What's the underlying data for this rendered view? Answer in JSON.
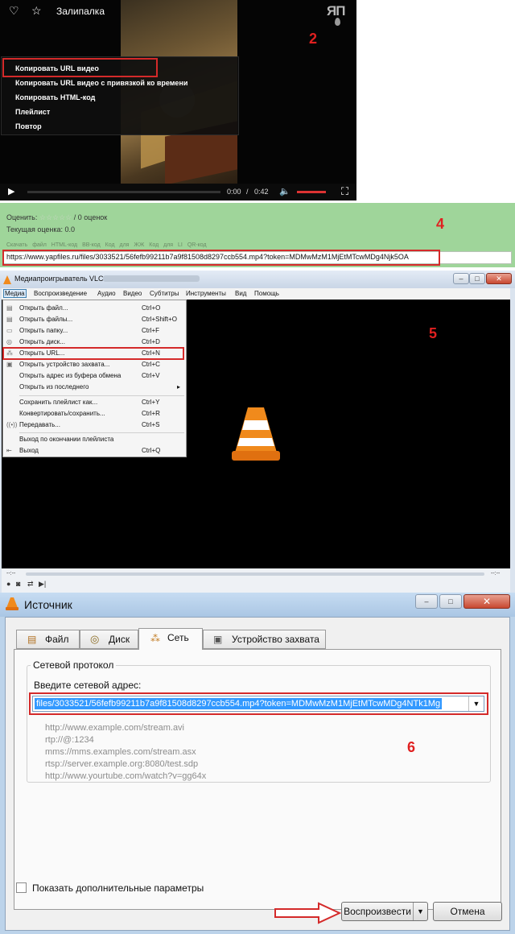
{
  "step_numbers": {
    "s2": "2",
    "s4": "4",
    "s5": "5",
    "s6": "6"
  },
  "player": {
    "title": "Залипалка",
    "logo": "ЯП",
    "context_menu": [
      "Копировать URL видео",
      "Копировать URL видео с привязкой ко времени",
      "Копировать HTML-код",
      "Плейлист",
      "Повтор"
    ],
    "time_current": "0:00",
    "time_separator": "/",
    "time_total": "0:42",
    "volume_fraction": 1.0
  },
  "rating": {
    "rate_label": "Оценить:",
    "stars": "☆☆☆☆☆",
    "rate_count": "/ 0 оценок",
    "current_rating": "Текущая оценка: 0.0",
    "links": "Скачать файл  HTML-код  BB-код  Код для ЖЖ  Код для LI  QR-код",
    "url": "https://www.yapfiles.ru/files/3033521/56fefb99211b7a9f81508d8297ccb554.mp4?token=MDMwMzM1MjEtMTcwMDg4Njk5OA"
  },
  "vlc": {
    "window_title": "Медиапроигрыватель VLC",
    "menubar": [
      "Медиа",
      "Воспроизведение",
      "Аудио",
      "Видео",
      "Субтитры",
      "Инструменты",
      "Вид",
      "Помощь"
    ],
    "media_menu": [
      {
        "label": "Открыть файл...",
        "shortcut": "Ctrl+O"
      },
      {
        "label": "Открыть файлы...",
        "shortcut": "Ctrl+Shift+O"
      },
      {
        "label": "Открыть папку...",
        "shortcut": "Ctrl+F"
      },
      {
        "label": "Открыть диск...",
        "shortcut": "Ctrl+D"
      },
      {
        "label": "Открыть URL...",
        "shortcut": "Ctrl+N"
      },
      {
        "label": "Открыть устройство захвата...",
        "shortcut": "Ctrl+C"
      },
      {
        "label": "Открыть адрес из буфера обмена",
        "shortcut": "Ctrl+V"
      },
      {
        "label": "Открыть из последнего",
        "shortcut": ""
      },
      {
        "label": "Сохранить плейлист как...",
        "shortcut": "Ctrl+Y"
      },
      {
        "label": "Конвертировать/сохранить...",
        "shortcut": "Ctrl+R"
      },
      {
        "label": "Передавать...",
        "shortcut": "Ctrl+S"
      },
      {
        "label": "Выход по окончании плейлиста",
        "shortcut": ""
      },
      {
        "label": "Выход",
        "shortcut": "Ctrl+Q"
      }
    ],
    "time_left": "--:--",
    "time_right": "--:--"
  },
  "source_dialog": {
    "title": "Источник",
    "tabs": [
      "Файл",
      "Диск",
      "Сеть",
      "Устройство захвата"
    ],
    "active_tab": "Сеть",
    "group_label": "Сетевой протокол",
    "address_label": "Введите сетевой адрес:",
    "address_value": "files/3033521/56fefb99211b7a9f81508d8297ccb554.mp4?token=MDMwMzM1MjEtMTcwMDg4NTk1Mg",
    "examples": [
      "http://www.example.com/stream.avi",
      "rtp://@:1234",
      "mms://mms.examples.com/stream.asx",
      "rtsp://server.example.org:8080/test.sdp",
      "http://www.yourtube.com/watch?v=gg64x"
    ],
    "show_more_label": "Показать дополнительные параметры",
    "play_button": "Воспроизвести",
    "cancel_button": "Отмена"
  },
  "colors": {
    "highlight_red": "#d42a2a",
    "accent_orange": "#f08a1c",
    "rating_green": "#9fd59a",
    "selection_blue": "#3399ff"
  }
}
